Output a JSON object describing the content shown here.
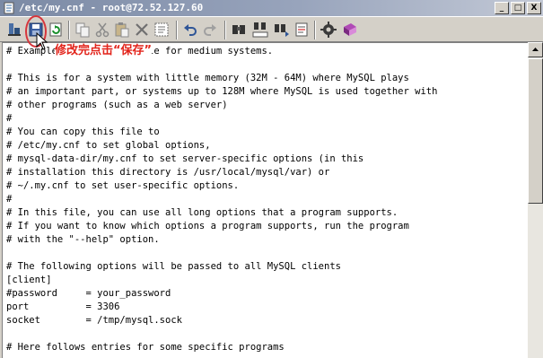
{
  "window": {
    "title": "/etc/my.cnf - root@72.52.127.60",
    "controls": [
      "_",
      "□",
      "X"
    ]
  },
  "toolbar": {
    "buttons": [
      {
        "name": "transfer-icon"
      },
      {
        "name": "save-icon"
      },
      {
        "name": "reload-icon"
      },
      {
        "name": "copy-icon"
      },
      {
        "name": "cut-icon"
      },
      {
        "name": "paste-icon"
      },
      {
        "name": "delete-icon"
      },
      {
        "name": "select-all-icon"
      },
      {
        "name": "undo-icon"
      },
      {
        "name": "redo-icon"
      },
      {
        "name": "find-icon"
      },
      {
        "name": "find-replace-icon"
      },
      {
        "name": "find-next-icon"
      },
      {
        "name": "goto-icon"
      },
      {
        "name": "settings-icon"
      },
      {
        "name": "help-book-icon"
      }
    ]
  },
  "annotation": {
    "text": "修改完点击“保存”",
    "color": "#e2231a"
  },
  "editor": {
    "lines": [
      "# Example MySQL config file for medium systems.",
      "",
      "# This is for a system with little memory (32M - 64M) where MySQL plays",
      "# an important part, or systems up to 128M where MySQL is used together with",
      "# other programs (such as a web server)",
      "#",
      "# You can copy this file to",
      "# /etc/my.cnf to set global options,",
      "# mysql-data-dir/my.cnf to set server-specific options (in this",
      "# installation this directory is /usr/local/mysql/var) or",
      "# ~/.my.cnf to set user-specific options.",
      "#",
      "# In this file, you can use all long options that a program supports.",
      "# If you want to know which options a program supports, run the program",
      "# with the \"--help\" option.",
      "",
      "# The following options will be passed to all MySQL clients",
      "[client]",
      "#password     = your_password",
      "port          = 3306",
      "socket        = /tmp/mysql.sock",
      "",
      "# Here follows entries for some specific programs"
    ]
  }
}
